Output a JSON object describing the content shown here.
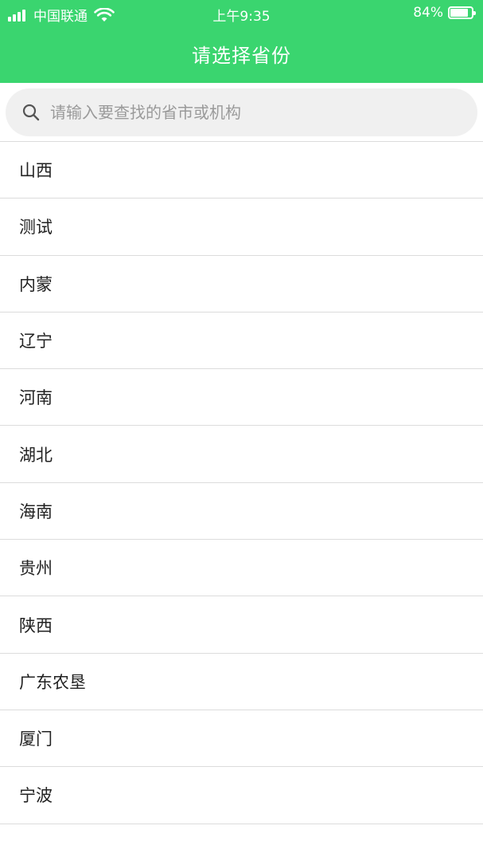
{
  "status_bar": {
    "carrier": "中国联通",
    "time": "上午9:35",
    "battery": "84%",
    "battery_level": 0.84
  },
  "header": {
    "title": "请选择省份"
  },
  "search": {
    "placeholder": "请输入要查找的省市或机构",
    "value": ""
  },
  "provinces": [
    "山西",
    "测试",
    "内蒙",
    "辽宁",
    "河南",
    "湖北",
    "海南",
    "贵州",
    "陕西",
    "广东农垦",
    "厦门",
    "宁波"
  ],
  "colors": {
    "accent": "#3ad56f",
    "search_bg": "#f0f0f0",
    "divider": "#dcdcdc"
  }
}
